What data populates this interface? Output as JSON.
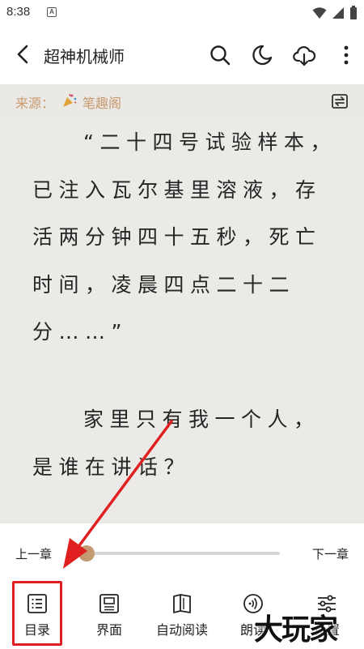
{
  "status_bar": {
    "time": "8:38",
    "notification_badge": "A"
  },
  "app_bar": {
    "title": "超神机械师"
  },
  "source_bar": {
    "label": "来源：",
    "source_name": "笔趣阁"
  },
  "content": {
    "paragraphs": [
      "“二十四号试验样本，已注入瓦尔基里溶液，存活两分钟四十五秒，死亡时间，凌晨四点二十二分……”",
      "家里只有我一个人，是谁在讲话？"
    ]
  },
  "chapter_nav": {
    "prev_label": "上一章",
    "next_label": "下一章",
    "progress_fraction": 0.0
  },
  "toolbar": {
    "items": [
      {
        "label": "目录",
        "icon": "toc-icon"
      },
      {
        "label": "界面",
        "icon": "layout-icon"
      },
      {
        "label": "自动阅读",
        "icon": "book-icon"
      },
      {
        "label": "朗读",
        "icon": "speak-icon"
      },
      {
        "label": "设置",
        "icon": "settings-icon"
      }
    ]
  },
  "annotation": {
    "arrow_color": "#e02020",
    "highlight_color": "#e02020"
  },
  "watermark": {
    "text": "大玩家"
  },
  "colors": {
    "accent": "#c49a72",
    "reader_background": "#eceae7",
    "source_text": "#c89a6d"
  }
}
